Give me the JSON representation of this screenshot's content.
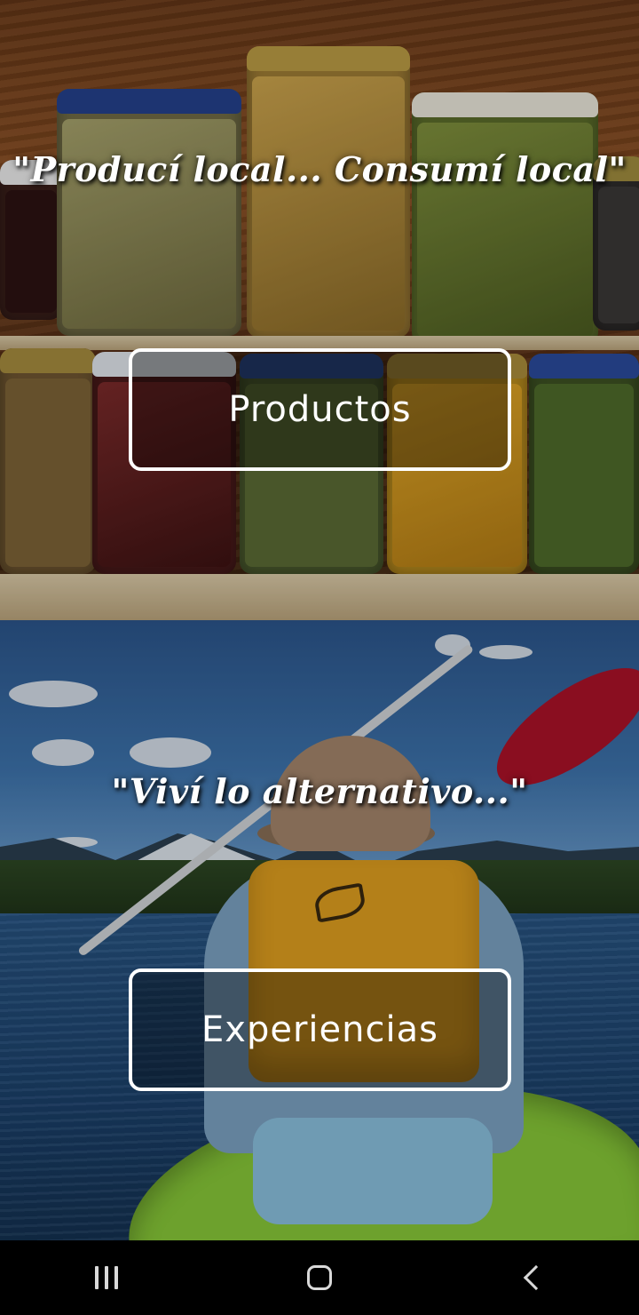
{
  "products": {
    "tagline": "\"Producí local... Consumí local\"",
    "button_label": "Productos"
  },
  "experiences": {
    "tagline": "\"Viví lo alternativo...\"",
    "button_label": "Experiencias"
  },
  "nav_bar": {
    "recents_icon": "recents-icon",
    "home_icon": "home-icon",
    "back_icon": "back-icon"
  },
  "colors": {
    "overlay_text": "#ffffff",
    "button_border": "#ffffff",
    "nav_background": "#000000"
  }
}
